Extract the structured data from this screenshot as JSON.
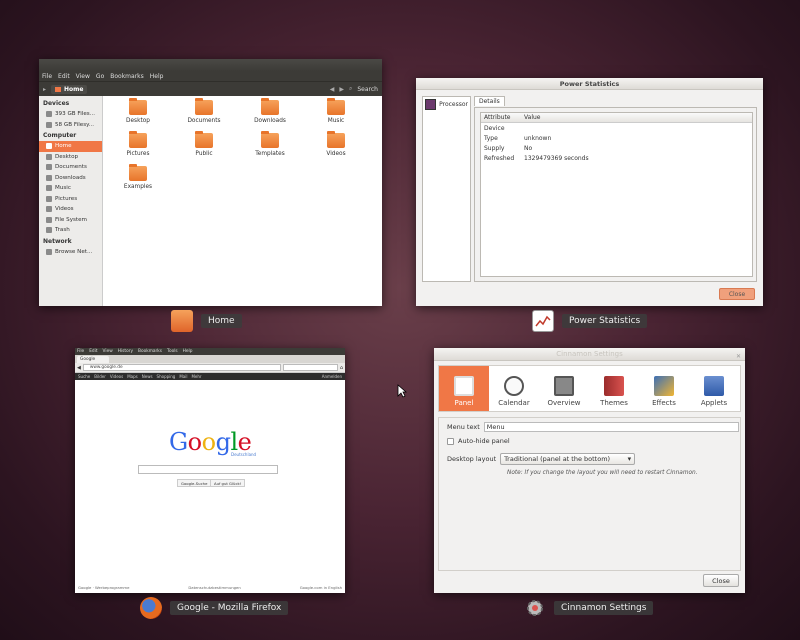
{
  "windows": {
    "nautilus": {
      "menu": [
        "File",
        "Edit",
        "View",
        "Go",
        "Bookmarks",
        "Help"
      ],
      "location": "Home",
      "search_label": "Search",
      "sidebar": {
        "devices_head": "Devices",
        "devices": [
          "393 GB Files...",
          "58 GB Filesy..."
        ],
        "computer_head": "Computer",
        "computer": [
          "Home",
          "Desktop",
          "Documents",
          "Downloads",
          "Music",
          "Pictures",
          "Videos",
          "File System",
          "Trash"
        ],
        "network_head": "Network",
        "network": [
          "Browse Net..."
        ]
      },
      "files": [
        "Desktop",
        "Documents",
        "Downloads",
        "Music",
        "Pictures",
        "Public",
        "Templates",
        "Videos",
        "Examples"
      ]
    },
    "power": {
      "title": "Power Statistics",
      "device": "Processor",
      "tab": "Details",
      "headers": [
        "Attribute",
        "Value"
      ],
      "rows": [
        [
          "Device",
          ""
        ],
        [
          "Type",
          "unknown"
        ],
        [
          "Supply",
          "No"
        ],
        [
          "Refreshed",
          "1329479369 seconds"
        ]
      ],
      "close_label": "Close"
    },
    "firefox": {
      "menu": [
        "File",
        "Edit",
        "View",
        "History",
        "Bookmarks",
        "Tools",
        "Help"
      ],
      "tab": "Google",
      "url": "www.google.de",
      "gbar": [
        "Suche",
        "Bilder",
        "Videos",
        "Maps",
        "News",
        "Shopping",
        "Mail",
        "Mehr"
      ],
      "gbar_right": "Anmelden",
      "logo": "Google",
      "logo_sub": "Deutschland",
      "btn_search": "Google-Suche",
      "btn_lucky": "Auf gut Glück!",
      "footer": [
        "Google · Werbeprogramme",
        "Datenschutzbestimmungen",
        "Google.com in English"
      ]
    },
    "cinnamon": {
      "title": "Cinnamon Settings",
      "items": [
        "Panel",
        "Calendar",
        "Overview",
        "Themes",
        "Effects",
        "Applets"
      ],
      "menu_text_label": "Menu text",
      "menu_text_value": "Menu",
      "autohide_label": "Auto-hide panel",
      "layout_label": "Desktop layout",
      "layout_value": "Traditional (panel at the bottom)",
      "note": "Note: If you change the layout you will need to restart Cinnamon.",
      "close_label": "Close"
    }
  },
  "captions": {
    "home": "Home",
    "power": "Power Statistics",
    "firefox": "Google - Mozilla Firefox",
    "cinnamon": "Cinnamon Settings"
  },
  "colors": {
    "accent": "#f07746",
    "background": "#4a2433"
  }
}
